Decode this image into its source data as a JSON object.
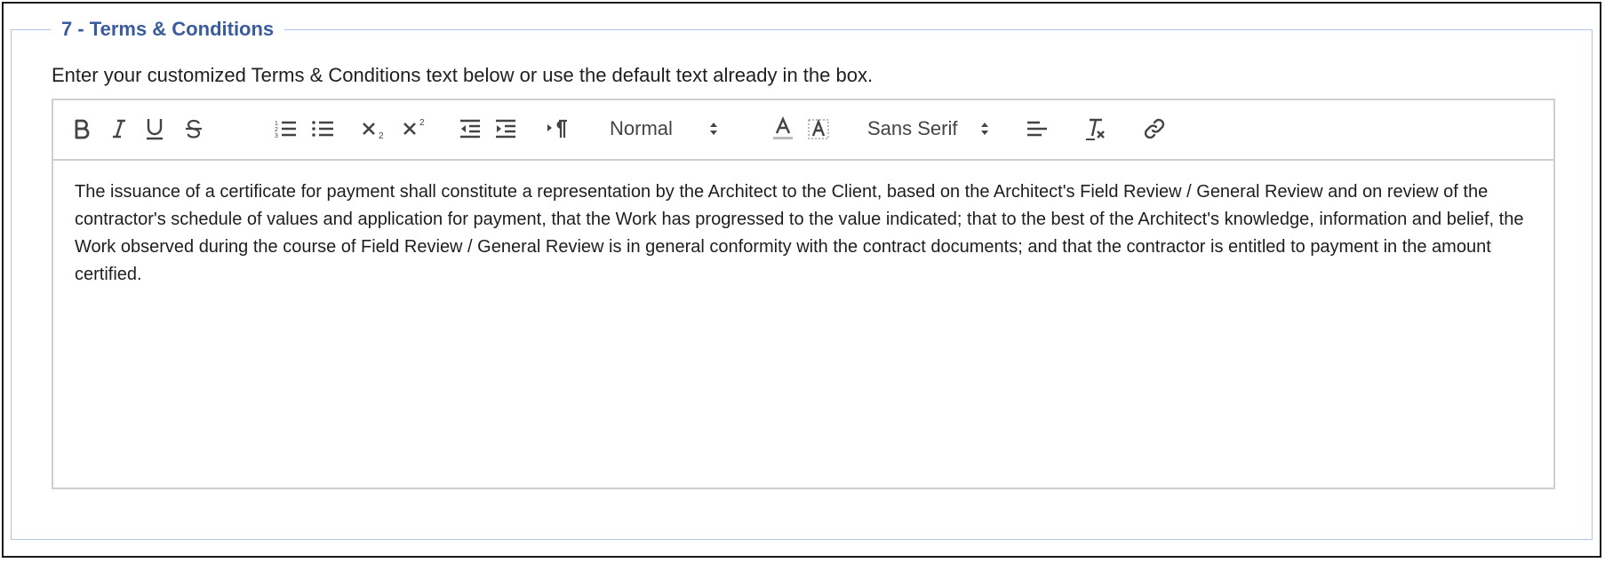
{
  "section": {
    "legend": "7 - Terms & Conditions",
    "instructions": "Enter your customized Terms & Conditions text below or use the default text already in the box."
  },
  "toolbar": {
    "buttons": [
      {
        "name": "bold-button",
        "icon": "bold-icon"
      },
      {
        "name": "italic-button",
        "icon": "italic-icon"
      },
      {
        "name": "underline-button",
        "icon": "underline-icon"
      },
      {
        "name": "strikethrough-button",
        "icon": "strikethrough-icon"
      },
      {
        "name": "ordered-list-button",
        "icon": "ordered-list-icon"
      },
      {
        "name": "bullet-list-button",
        "icon": "bullet-list-icon"
      },
      {
        "name": "subscript-button",
        "icon": "subscript-icon"
      },
      {
        "name": "superscript-button",
        "icon": "superscript-icon"
      },
      {
        "name": "outdent-button",
        "icon": "outdent-icon"
      },
      {
        "name": "indent-button",
        "icon": "indent-icon"
      },
      {
        "name": "text-direction-button",
        "icon": "rtl-paragraph-icon"
      },
      {
        "name": "text-color-button",
        "icon": "text-color-icon"
      },
      {
        "name": "background-color-button",
        "icon": "background-color-icon"
      },
      {
        "name": "align-button",
        "icon": "align-left-icon"
      },
      {
        "name": "clear-formatting-button",
        "icon": "clear-format-icon"
      },
      {
        "name": "link-button",
        "icon": "link-icon"
      }
    ],
    "header_picker": "Normal",
    "font_picker": "Sans Serif"
  },
  "editor": {
    "content": "The issuance of a certificate for payment shall constitute a representation by the Architect to the Client, based on the Architect's Field Review / General Review and on review of the contractor's schedule of values and application for payment, that the Work has progressed to the value indicated; that to the best of the Architect's knowledge, information and belief, the Work observed during the course of Field Review / General Review is in general conformity with the contract documents; and that the contractor is entitled to payment in the amount certified."
  },
  "colors": {
    "legend": "#3a5b9c",
    "fieldset_border": "#b4c4e6",
    "editor_border": "#cfcfcf",
    "icon": "#444444"
  }
}
